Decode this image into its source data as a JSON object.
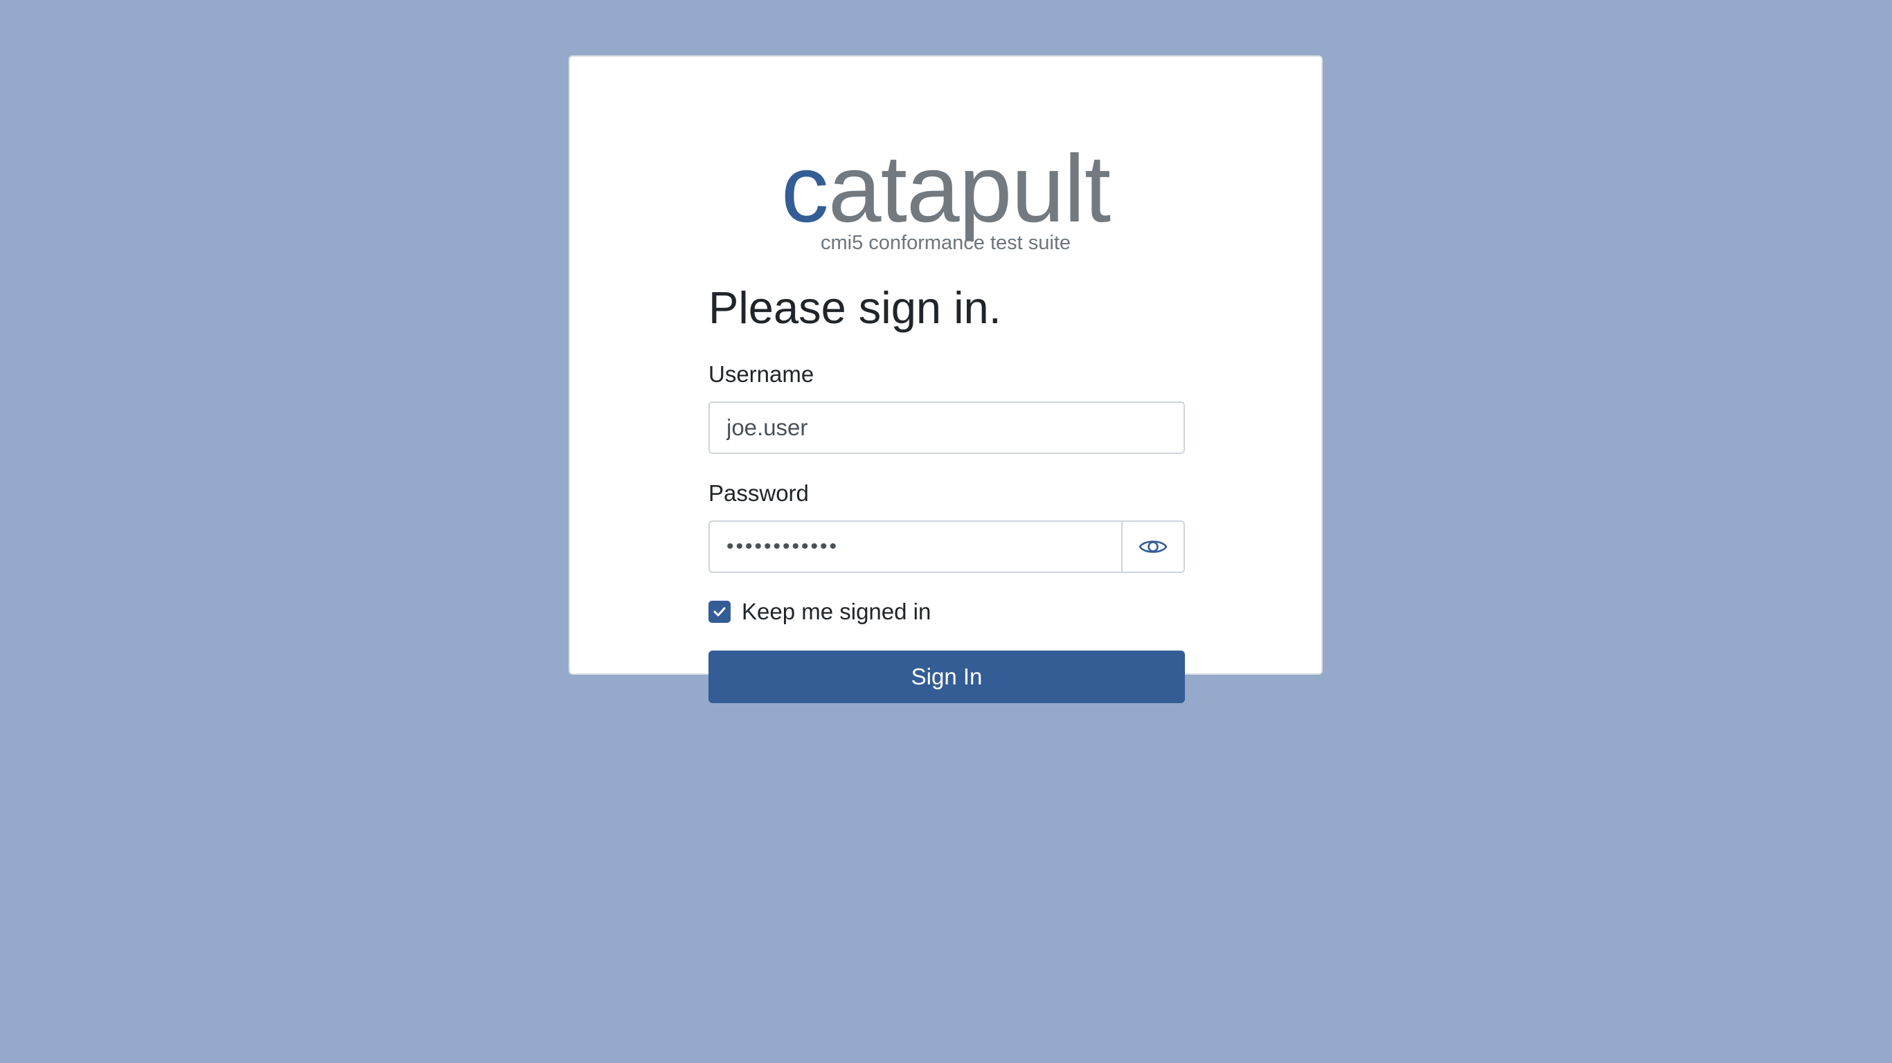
{
  "logo": {
    "first_letter": "c",
    "rest": "atapult",
    "tagline": "cmi5 conformance test suite"
  },
  "form": {
    "heading": "Please sign in.",
    "username": {
      "label": "Username",
      "value": "joe.user"
    },
    "password": {
      "label": "Password",
      "value": "••••••••••••",
      "toggle_icon": "eye-icon"
    },
    "remember": {
      "label": "Keep me signed in",
      "checked": true
    },
    "submit_label": "Sign In"
  },
  "colors": {
    "background": "#95aaca",
    "accent": "#345d96",
    "logo_gray": "#727a80"
  }
}
